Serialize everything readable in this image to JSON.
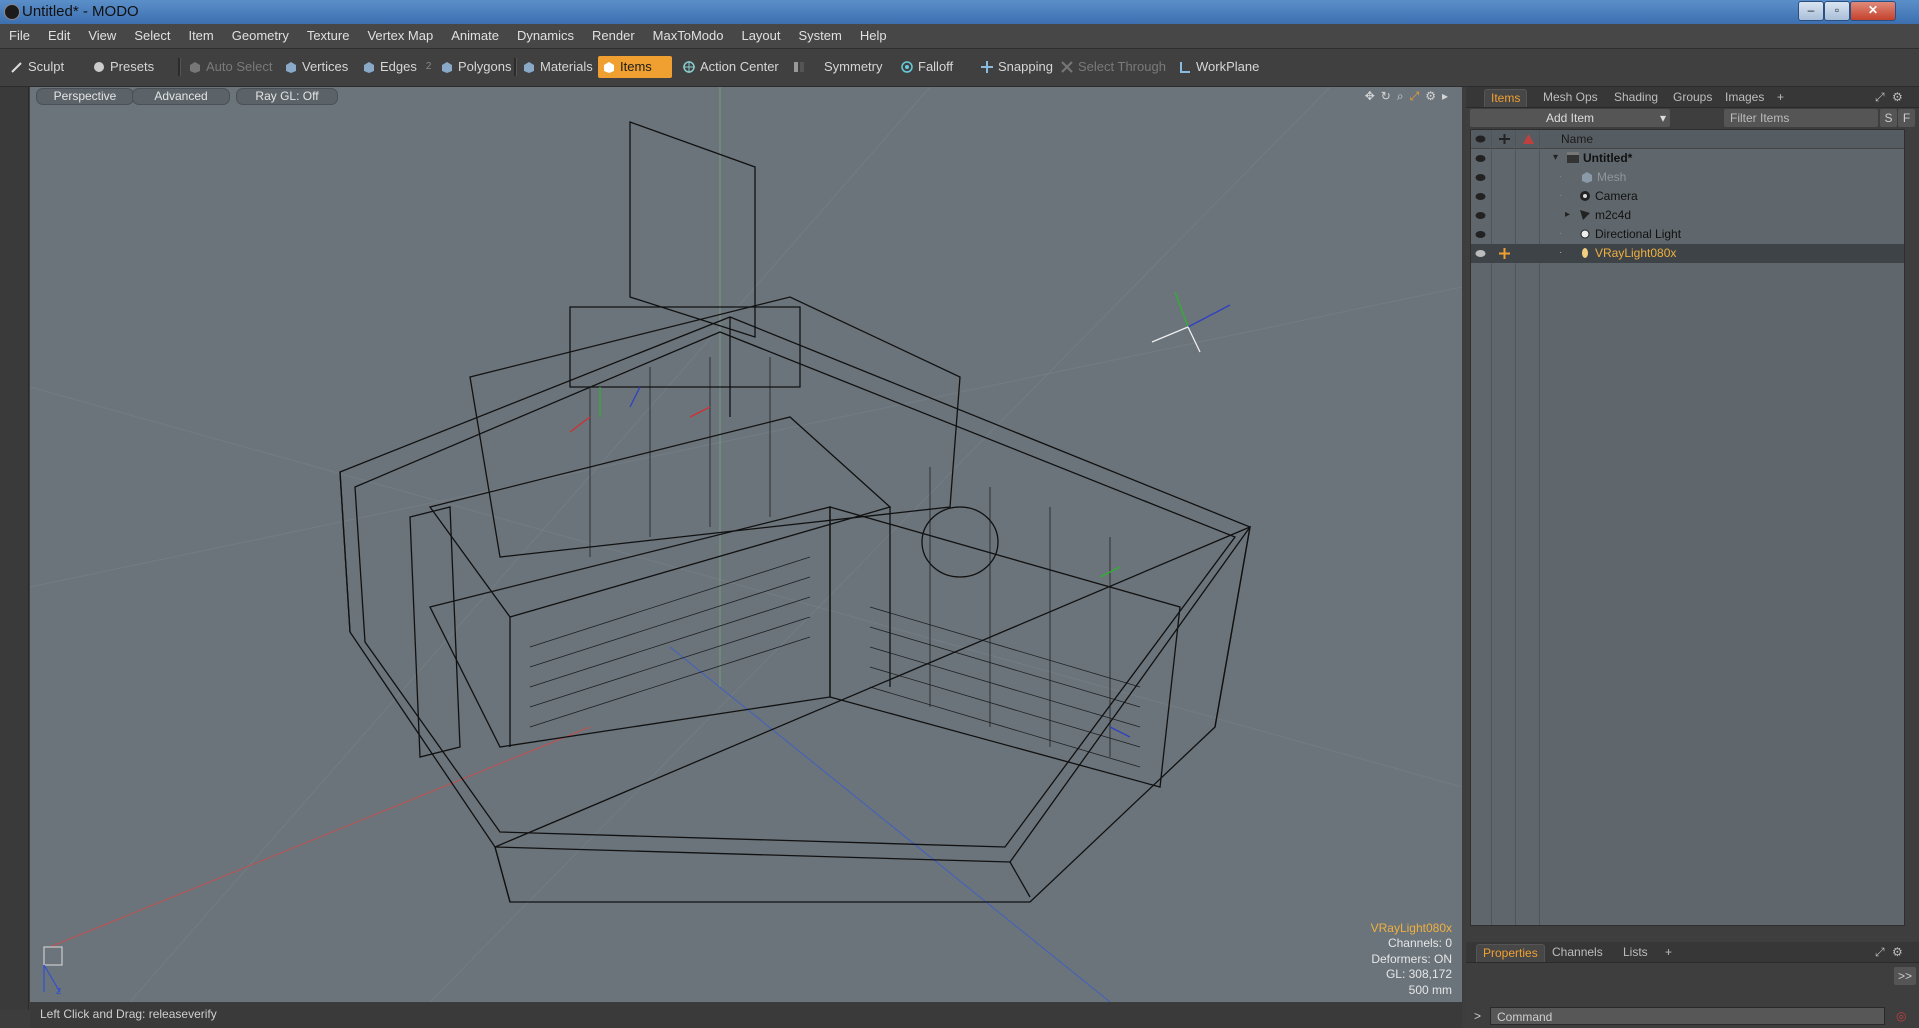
{
  "window": {
    "title": "Untitled* - MODO"
  },
  "menubar": [
    "File",
    "Edit",
    "View",
    "Select",
    "Item",
    "Geometry",
    "Texture",
    "Vertex Map",
    "Animate",
    "Dynamics",
    "Render",
    "MaxToModo",
    "Layout",
    "System",
    "Help"
  ],
  "toolbar": {
    "sculpt": "Sculpt",
    "presets": "Presets",
    "auto_select": "Auto Select",
    "vertices": "Vertices",
    "edges": "Edges",
    "edges_count": "2",
    "polygons": "Polygons",
    "materials": "Materials",
    "items": "Items",
    "action_center": "Action Center",
    "symmetry": "Symmetry",
    "falloff": "Falloff",
    "snapping": "Snapping",
    "select_through": "Select Through",
    "workplane": "WorkPlane"
  },
  "viewport": {
    "view_mode": "Perspective",
    "shading": "Advanced",
    "raygl": "Ray GL: Off",
    "info": {
      "selected": "VRayLight080x",
      "channels": "Channels: 0",
      "deformers": "Deformers: ON",
      "gl": "GL: 308,172",
      "scale": "500 mm"
    }
  },
  "statusbar": {
    "hint": "Left Click and Drag:  releaseverify"
  },
  "right_panel": {
    "tabs": [
      "Items",
      "Mesh Ops",
      "Shading",
      "Groups",
      "Images"
    ],
    "add_item": "Add Item",
    "filter_placeholder": "Filter Items",
    "btn_s": "S",
    "btn_f": "F",
    "column_name": "Name",
    "items": [
      {
        "label": "Untitled*",
        "bold": true,
        "selected": false,
        "dim": false
      },
      {
        "label": "Mesh",
        "bold": false,
        "selected": false,
        "dim": true
      },
      {
        "label": "Camera",
        "bold": false,
        "selected": false,
        "dim": false
      },
      {
        "label": "m2c4d",
        "bold": false,
        "selected": false,
        "dim": false
      },
      {
        "label": "Directional Light",
        "bold": false,
        "selected": false,
        "dim": false
      },
      {
        "label": "VRayLight080x",
        "bold": false,
        "selected": true,
        "dim": false
      }
    ],
    "bottom_tabs": [
      "Properties",
      "Channels",
      "Lists"
    ],
    "expand_btn": ">>",
    "command_placeholder": "Command"
  },
  "colors": {
    "accent": "#f0a030",
    "viewport_bg": "#6b747b",
    "selection_text": "#f0b040"
  }
}
